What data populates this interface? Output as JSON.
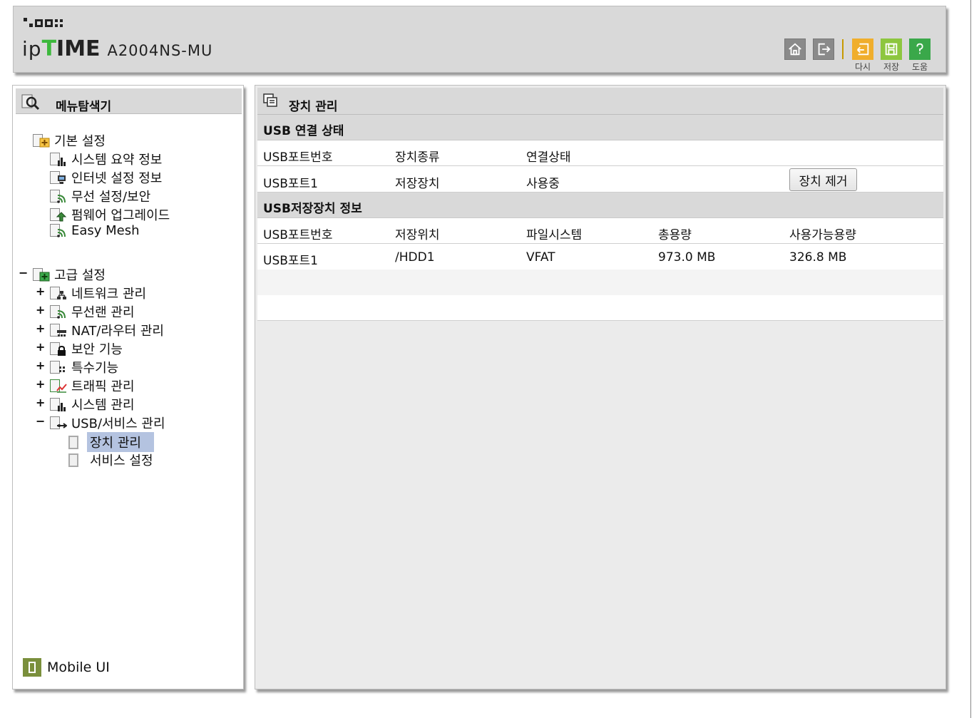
{
  "header": {
    "brand_ip": "ip",
    "brand_t": "T",
    "brand_ime": "IME",
    "model": "A2004NS-MU",
    "buttons": {
      "home_icon": "home-icon",
      "logout_icon": "logout-icon",
      "reload_label": "다시",
      "save_label": "저장",
      "help_label": "도움"
    },
    "colors": {
      "reload": "#f0ae2c",
      "save": "#8dc63f",
      "help": "#3aa84a",
      "gray": "#8a8a8a"
    }
  },
  "menu": {
    "title": "메뉴탐색기",
    "basic": {
      "label": "기본 설정",
      "items": [
        "시스템 요약 정보",
        "인터넷 설정 정보",
        "무선 설정/보안",
        "펌웨어 업그레이드",
        "Easy Mesh"
      ]
    },
    "advanced": {
      "label": "고급 설정",
      "expander": "−",
      "items": [
        {
          "label": "네트워크 관리",
          "expander": "+"
        },
        {
          "label": "무선랜 관리",
          "expander": "+"
        },
        {
          "label": "NAT/라우터 관리",
          "expander": "+"
        },
        {
          "label": "보안 기능",
          "expander": "+"
        },
        {
          "label": "특수기능",
          "expander": "+"
        },
        {
          "label": "트래픽 관리",
          "expander": "+"
        },
        {
          "label": "시스템 관리",
          "expander": "+"
        },
        {
          "label": "USB/서비스 관리",
          "expander": "−"
        }
      ],
      "usb_children": [
        "장치 관리",
        "서비스 설정"
      ]
    },
    "mobile_ui": "Mobile UI"
  },
  "main": {
    "title": "장치 관리",
    "usb_connection": {
      "heading": "USB 연결 상태",
      "columns": [
        "USB포트번호",
        "장치종류",
        "연결상태"
      ],
      "rows": [
        {
          "port": "USB포트1",
          "type": "저장장치",
          "status": "사용중",
          "action": "장치 제거"
        }
      ]
    },
    "usb_storage": {
      "heading": "USB저장장치 정보",
      "columns": [
        "USB포트번호",
        "저장위치",
        "파일시스템",
        "총용량",
        "사용가능용량"
      ],
      "rows": [
        {
          "port": "USB포트1",
          "location": "/HDD1",
          "fs": "VFAT",
          "total": "973.0 MB",
          "free": "326.8 MB"
        }
      ]
    }
  }
}
